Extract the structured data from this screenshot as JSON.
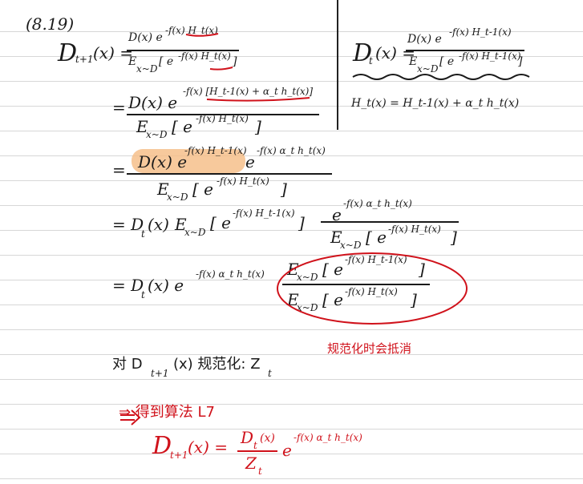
{
  "ref": "(8.19)",
  "lhs_left": "D",
  "lhs_left_sub": "t+1",
  "lhs_left_arg": "(x) =",
  "frac1_num": "D(x) e",
  "frac1_num_exp": "-f(x) H_t(x)",
  "frac1_den": "E",
  "frac1_den_sub": "x~D",
  "frac1_den_rest": "[ e",
  "frac1_den_exp": "-f(x) H_t(x)",
  "frac1_den_close": "]",
  "right_lhs": "D",
  "right_lhs_sub": "t",
  "right_lhs_arg": "(x) =",
  "right_num": "D(x) e",
  "right_num_exp": "-f(x) H_t-1(x)",
  "right_den": "E",
  "right_den_sub": "x~D",
  "right_den_rest": "[ e",
  "right_den_exp": "-f(x) H_t-1(x)",
  "right_den_close": "]",
  "right_H": "H_t(x) = H_t-1(x) + α_t h_t(x)",
  "eq2_prefix": "=",
  "eq2_num": "D(x) e",
  "eq2_num_exp": "-f(x) [H_t-1(x) + α_t h_t(x)]",
  "eq2_den": "E",
  "eq2_den_sub": "x~D",
  "eq2_den_rest": "[ e",
  "eq2_den_exp": "-f(x) H_t(x)",
  "eq2_den_close": "]",
  "eq3_prefix": "=",
  "eq3_num_a": "D(x) e",
  "eq3_num_a_exp": "-f(x) H_t-1(x)",
  "eq3_num_b": "e",
  "eq3_num_b_exp": "-f(x) α_t h_t(x)",
  "eq3_den": "E",
  "eq3_den_sub": "x~D",
  "eq3_den_rest": "[ e",
  "eq3_den_exp": "-f(x) H_t(x)",
  "eq3_den_close": "]",
  "eq4_prefix": "= D",
  "eq4_prefix_sub": "t",
  "eq4_prefix_arg": "(x)",
  "eq4_E": "E",
  "eq4_E_sub": "x~D",
  "eq4_E_rest": "[ e",
  "eq4_E_exp": "-f(x) H_t-1(x)",
  "eq4_E_close": "]",
  "eq4_num": "e",
  "eq4_num_exp": "-f(x) α_t h_t(x)",
  "eq4_den": "E",
  "eq4_den_sub": "x~D",
  "eq4_den_rest": "[ e",
  "eq4_den_exp": "-f(x) H_t(x)",
  "eq4_den_close": "]",
  "eq5_prefix": "= D",
  "eq5_prefix_sub": "t",
  "eq5_prefix_arg": "(x) e",
  "eq5_prefix_exp": "-f(x) α_t h_t(x)",
  "eq5_num": "E",
  "eq5_num_sub": "x~D",
  "eq5_num_rest": "[ e",
  "eq5_num_exp": "-f(x) H_t-1(x)",
  "eq5_num_close": "]",
  "eq5_den": "E",
  "eq5_den_sub": "x~D",
  "eq5_den_rest": "[ e",
  "eq5_den_exp": "-f(x) H_t(x)",
  "eq5_den_close": "]",
  "note_red": "规范化时会抵消",
  "normalize_line": "对 D",
  "normalize_sub": "t+1",
  "normalize_rest": "(x) 规范化: Z",
  "normalize_z_sub": "t",
  "conclusion_red": "⇒ 得到算法 L7",
  "final_lhs": "D",
  "final_lhs_sub": "t+1",
  "final_lhs_arg": "(x) =",
  "final_num": "D",
  "final_num_sub": "t",
  "final_num_arg": "(x)",
  "final_den": "Z",
  "final_den_sub": "t",
  "final_exp_base": "e",
  "final_exp": "-f(x) α_t h_t(x)",
  "colors": {
    "ink": "#1a1a1a",
    "red": "#d0121b",
    "highlight": "#f6c08b",
    "rule": "#d7d7d7"
  }
}
